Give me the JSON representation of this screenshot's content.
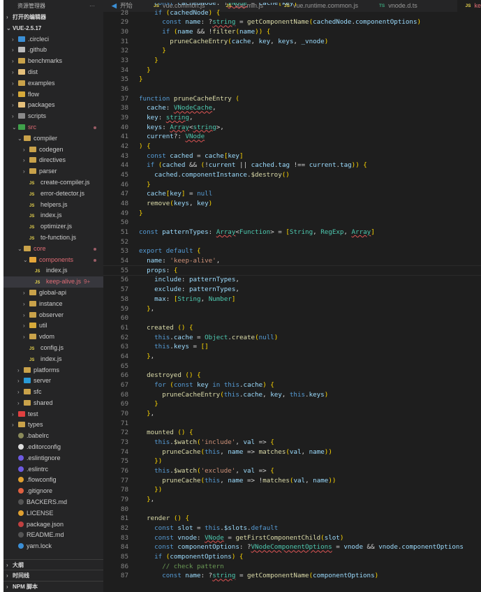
{
  "sidebar": {
    "title": "资源管理器",
    "more": "···",
    "open_editors": "打开的编辑器",
    "root": "VUE-2.5.17",
    "items": [
      {
        "label": ".circleci",
        "depth": 1,
        "kind": "folder",
        "open": false,
        "icon": "#3b8fd6"
      },
      {
        "label": ".github",
        "depth": 1,
        "kind": "folder",
        "open": false,
        "icon": "#bbbbbb"
      },
      {
        "label": "benchmarks",
        "depth": 1,
        "kind": "folder",
        "open": false,
        "icon": "#c9a24a"
      },
      {
        "label": "dist",
        "depth": 1,
        "kind": "folder",
        "open": false,
        "icon": "#e5c07b"
      },
      {
        "label": "examples",
        "depth": 1,
        "kind": "folder",
        "open": false,
        "icon": "#c9a24a"
      },
      {
        "label": "flow",
        "depth": 1,
        "kind": "folder",
        "open": false,
        "icon": "#d6a93a"
      },
      {
        "label": "packages",
        "depth": 1,
        "kind": "folder",
        "open": false,
        "icon": "#e5c07b"
      },
      {
        "label": "scripts",
        "depth": 1,
        "kind": "folder",
        "open": false,
        "icon": "#8a8a8a"
      },
      {
        "label": "src",
        "depth": 1,
        "kind": "folder",
        "open": true,
        "icon": "#3fa14a",
        "modified": true,
        "dot": true
      },
      {
        "label": "compiler",
        "depth": 2,
        "kind": "folder",
        "open": true,
        "icon": "#c9a24a"
      },
      {
        "label": "codegen",
        "depth": 3,
        "kind": "folder",
        "open": false,
        "icon": "#c9a24a"
      },
      {
        "label": "directives",
        "depth": 3,
        "kind": "folder",
        "open": false,
        "icon": "#c9a24a"
      },
      {
        "label": "parser",
        "depth": 3,
        "kind": "folder",
        "open": false,
        "icon": "#c9a24a"
      },
      {
        "label": "create-compiler.js",
        "depth": 3,
        "kind": "js"
      },
      {
        "label": "error-detector.js",
        "depth": 3,
        "kind": "js"
      },
      {
        "label": "helpers.js",
        "depth": 3,
        "kind": "js"
      },
      {
        "label": "index.js",
        "depth": 3,
        "kind": "js"
      },
      {
        "label": "optimizer.js",
        "depth": 3,
        "kind": "js"
      },
      {
        "label": "to-function.js",
        "depth": 3,
        "kind": "js"
      },
      {
        "label": "core",
        "depth": 2,
        "kind": "folder",
        "open": true,
        "icon": "#c9a24a",
        "modified": true,
        "dot": true
      },
      {
        "label": "components",
        "depth": 3,
        "kind": "folder",
        "open": true,
        "icon": "#e5a63a",
        "modified": true,
        "dot": true
      },
      {
        "label": "index.js",
        "depth": 4,
        "kind": "js"
      },
      {
        "label": "keep-alive.js",
        "depth": 4,
        "kind": "js",
        "modified": true,
        "badge": "9+",
        "selected": true
      },
      {
        "label": "global-api",
        "depth": 3,
        "kind": "folder",
        "open": false,
        "icon": "#c9a24a"
      },
      {
        "label": "instance",
        "depth": 3,
        "kind": "folder",
        "open": false,
        "icon": "#c9a24a"
      },
      {
        "label": "observer",
        "depth": 3,
        "kind": "folder",
        "open": false,
        "icon": "#c9a24a"
      },
      {
        "label": "util",
        "depth": 3,
        "kind": "folder",
        "open": false,
        "icon": "#d6a93a"
      },
      {
        "label": "vdom",
        "depth": 3,
        "kind": "folder",
        "open": false,
        "icon": "#c9a24a"
      },
      {
        "label": "config.js",
        "depth": 3,
        "kind": "js"
      },
      {
        "label": "index.js",
        "depth": 3,
        "kind": "js"
      },
      {
        "label": "platforms",
        "depth": 2,
        "kind": "folder",
        "open": false,
        "icon": "#c9a24a"
      },
      {
        "label": "server",
        "depth": 2,
        "kind": "folder",
        "open": false,
        "icon": "#2a9ad6"
      },
      {
        "label": "sfc",
        "depth": 2,
        "kind": "folder",
        "open": false,
        "icon": "#c9a24a"
      },
      {
        "label": "shared",
        "depth": 2,
        "kind": "folder",
        "open": false,
        "icon": "#c9a24a"
      },
      {
        "label": "test",
        "depth": 1,
        "kind": "folder",
        "open": false,
        "icon": "#e04040"
      },
      {
        "label": "types",
        "depth": 1,
        "kind": "folder",
        "open": false,
        "icon": "#c9a24a"
      },
      {
        "label": ".babelrc",
        "depth": 1,
        "kind": "file",
        "icon": "#8a8a5a"
      },
      {
        "label": ".editorconfig",
        "depth": 1,
        "kind": "file",
        "icon": "#dddddd"
      },
      {
        "label": ".eslintignore",
        "depth": 1,
        "kind": "file",
        "icon": "#6d5ae0"
      },
      {
        "label": ".eslintrc",
        "depth": 1,
        "kind": "file",
        "icon": "#6d5ae0"
      },
      {
        "label": ".flowconfig",
        "depth": 1,
        "kind": "file",
        "icon": "#e0a030"
      },
      {
        "label": ".gitignore",
        "depth": 1,
        "kind": "file",
        "icon": "#e06040"
      },
      {
        "label": "BACKERS.md",
        "depth": 1,
        "kind": "file",
        "icon": "#555555"
      },
      {
        "label": "LICENSE",
        "depth": 1,
        "kind": "file",
        "icon": "#e0a030"
      },
      {
        "label": "package.json",
        "depth": 1,
        "kind": "file",
        "icon": "#c04040"
      },
      {
        "label": "README.md",
        "depth": 1,
        "kind": "file",
        "icon": "#555555"
      },
      {
        "label": "yarn.lock",
        "depth": 1,
        "kind": "file",
        "icon": "#3b8fd6"
      }
    ],
    "sections": [
      "大纲",
      "时间线",
      "NPM 脚本"
    ]
  },
  "tabs": [
    {
      "label": "开始",
      "icon": "vscode-icon",
      "iconText": "◀",
      "iconColor": "#3b8fd6"
    },
    {
      "label": "vue.common.js",
      "iconText": "JS",
      "iconColor": "#e8d44d"
    },
    {
      "label": "vue.min.js",
      "iconText": "JS",
      "iconColor": "#e8d44d"
    },
    {
      "label": "vue.runtime.common.js",
      "iconText": "JS",
      "iconColor": "#e8d44d"
    },
    {
      "label": "vnode.d.ts",
      "iconText": "TS",
      "iconColor": "#3aa37a"
    },
    {
      "label": "ke",
      "iconText": "JS",
      "iconColor": "#e8d44d",
      "active": true
    }
  ],
  "editor": {
    "first_line": 27,
    "current_line": 55,
    "lines": [
      "    const cachedNode: ?VNode = cache[key]",
      "    if (cachedNode) {",
      "      const name: ?string = getComponentName(cachedNode.componentOptions)",
      "      if (name && !filter(name)) {",
      "        pruneCacheEntry(cache, key, keys, _vnode)",
      "      }",
      "    }",
      "  }",
      "}",
      "",
      "function pruneCacheEntry (",
      "  cache: VNodeCache,",
      "  key: string,",
      "  keys: Array<string>,",
      "  current?: VNode",
      ") {",
      "  const cached = cache[key]",
      "  if (cached && (!current || cached.tag !== current.tag)) {",
      "    cached.componentInstance.$destroy()",
      "  }",
      "  cache[key] = null",
      "  remove(keys, key)",
      "}",
      "",
      "const patternTypes: Array<Function> = [String, RegExp, Array]",
      "",
      "export default {",
      "  name: 'keep-alive',",
      "  props: {",
      "    include: patternTypes,",
      "    exclude: patternTypes,",
      "    max: [String, Number]",
      "  },",
      "",
      "  created () {",
      "    this.cache = Object.create(null)",
      "    this.keys = []",
      "  },",
      "",
      "  destroyed () {",
      "    for (const key in this.cache) {",
      "      pruneCacheEntry(this.cache, key, this.keys)",
      "    }",
      "  },",
      "",
      "  mounted () {",
      "    this.$watch('include', val => {",
      "      pruneCache(this, name => matches(val, name))",
      "    })",
      "    this.$watch('exclude', val => {",
      "      pruneCache(this, name => !matches(val, name))",
      "    })",
      "  },",
      "",
      "  render () {",
      "    const slot = this.$slots.default",
      "    const vnode: VNode = getFirstComponentChild(slot)",
      "    const componentOptions: ?VNodeComponentOptions = vnode && vnode.componentOptions",
      "    if (componentOptions) {",
      "      // check pattern",
      "      const name: ?string = getComponentName(componentOptions)"
    ]
  },
  "colors": {
    "modified": "#e06c75",
    "keyword": "#569cd6",
    "string": "#ce9178",
    "type": "#4ec9b0",
    "function": "#dcdcaa",
    "variable": "#9cdcfe",
    "comment": "#6a9955"
  }
}
